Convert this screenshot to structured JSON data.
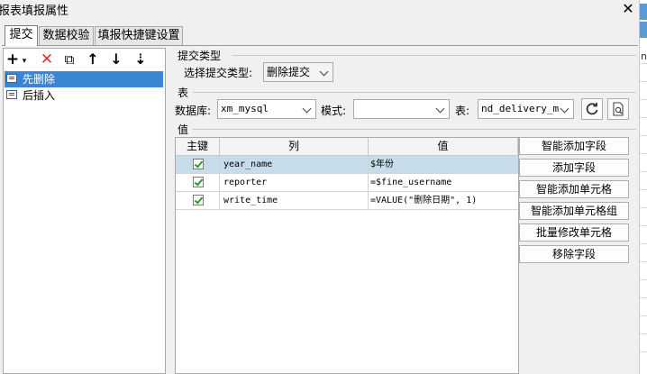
{
  "window": {
    "title": "报表填报属性",
    "close_glyph": "✕"
  },
  "tabs": [
    {
      "label": "提交",
      "active": true
    },
    {
      "label": "数据校验",
      "active": false
    },
    {
      "label": "填报快捷键设置",
      "active": false
    }
  ],
  "toolbar": {
    "icons": [
      "add-dropdown-icon",
      "delete-icon",
      "copy-icon",
      "move-up-icon",
      "move-down-icon",
      "sort-icon"
    ],
    "add_glyph": "+",
    "add_caret": "▾",
    "delete_glyph": "✕",
    "copy_glyph": "⧉",
    "up_glyph": "↑",
    "down_glyph": "↓",
    "sort_glyph": "⇣"
  },
  "tree": {
    "items": [
      {
        "label": "先删除",
        "selected": true
      },
      {
        "label": "后插入",
        "selected": false
      }
    ]
  },
  "submit_type": {
    "group_label": "提交类型",
    "select_label": "选择提交类型:",
    "selected": "删除提交"
  },
  "table_section": {
    "group_label": "表",
    "db_label": "数据库:",
    "db_value": "xm_mysql",
    "schema_label": "模式:",
    "schema_value": "",
    "table_label": "表:",
    "table_value": "nd_delivery_m"
  },
  "value_section": {
    "group_label": "值",
    "columns": [
      "主键",
      "列",
      "值"
    ],
    "rows": [
      {
        "key": true,
        "column": "year_name",
        "value": "$年份",
        "selected": true
      },
      {
        "key": true,
        "column": "reporter",
        "value": "=$fine_username",
        "selected": false
      },
      {
        "key": true,
        "column": "write_time",
        "value": "=VALUE(\"删除日期\", 1)",
        "selected": false
      }
    ],
    "buttons": [
      "智能添加字段",
      "添加字段",
      "智能添加单元格",
      "智能添加单元格组",
      "批量修改单元格",
      "移除字段"
    ]
  },
  "colors": {
    "selection": "#3a86d4",
    "row_selection": "#c7dcea",
    "delete_red": "#d9302c",
    "check_green": "#2a9d2a",
    "strip_blue": "#5b9bd5"
  },
  "right_strip": {
    "text": "no"
  }
}
